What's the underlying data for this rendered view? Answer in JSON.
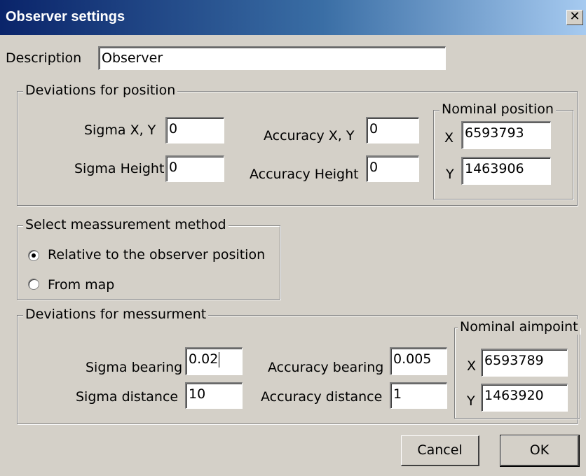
{
  "window": {
    "title": "Observer settings",
    "close_glyph": "✕"
  },
  "description": {
    "label": "Description",
    "value": "Observer"
  },
  "position_group": {
    "legend": "Deviations for position",
    "sigma_xy_label": "Sigma X, Y",
    "sigma_xy_value": "0",
    "sigma_height_label": "Sigma Height",
    "sigma_height_value": "0",
    "accuracy_xy_label": "Accuracy X, Y",
    "accuracy_xy_value": "0",
    "accuracy_height_label": "Accuracy Height",
    "accuracy_height_value": "0",
    "nominal": {
      "legend": "Nominal position",
      "x_label": "X",
      "x_value": "6593793",
      "y_label": "Y",
      "y_value": "1463906"
    }
  },
  "method_group": {
    "legend": "Select meassurement method",
    "options": [
      {
        "label": "Relative to the observer position",
        "selected": true
      },
      {
        "label": "From map",
        "selected": false
      }
    ]
  },
  "measurement_group": {
    "legend": "Deviations for messurment",
    "sigma_bearing_label": "Sigma bearing",
    "sigma_bearing_value": "0.02",
    "sigma_distance_label": "Sigma distance",
    "sigma_distance_value": "10",
    "accuracy_bearing_label": "Accuracy bearing",
    "accuracy_bearing_value": "0.005",
    "accuracy_distance_label": "Accuracy distance",
    "accuracy_distance_value": "1",
    "nominal": {
      "legend": "Nominal aimpoint",
      "x_label": "X",
      "x_value": "6593789",
      "y_label": "Y",
      "y_value": "1463920"
    }
  },
  "buttons": {
    "cancel": "Cancel",
    "ok": "OK"
  }
}
